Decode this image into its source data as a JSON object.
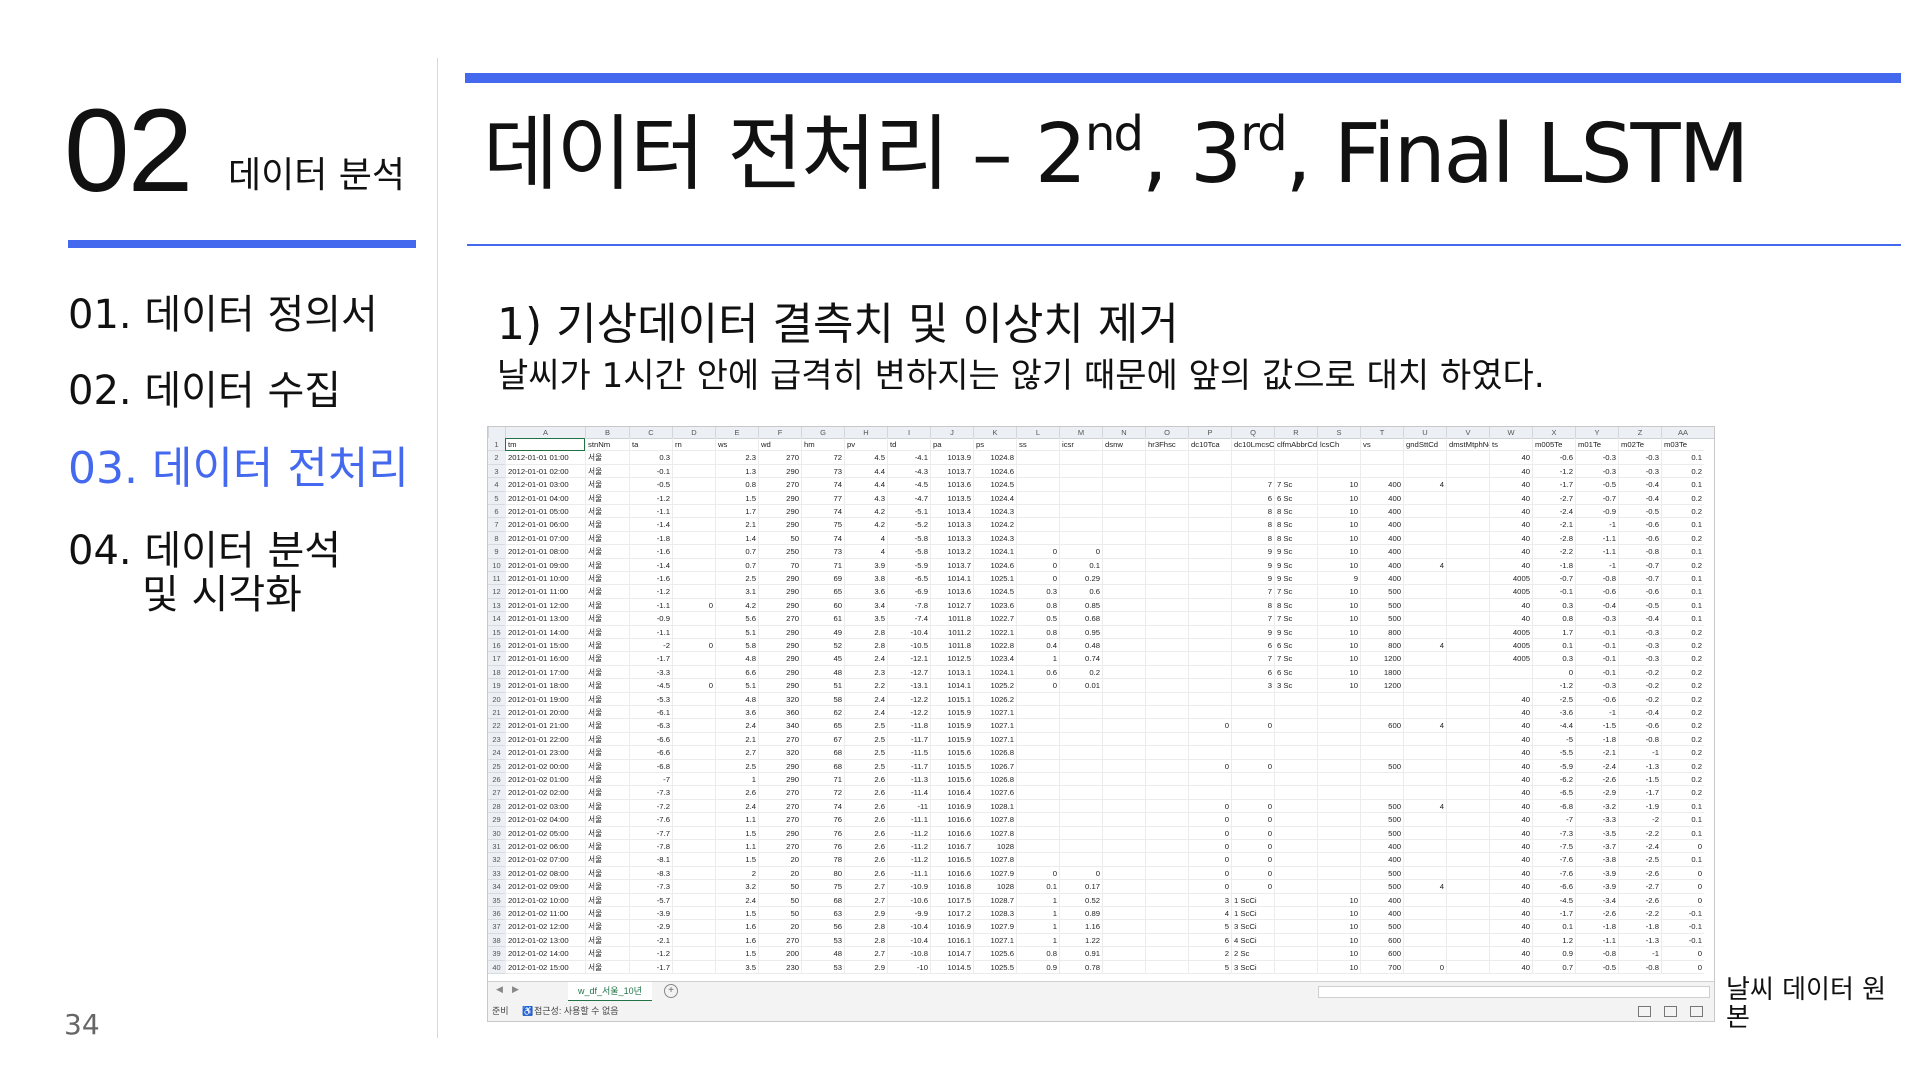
{
  "section": {
    "number": "02",
    "name": "데이터 분석"
  },
  "nav": {
    "items": [
      {
        "label": "01. 데이터 정의서"
      },
      {
        "label": "02. 데이터 수집"
      },
      {
        "label": "03. 데이터 전처리"
      },
      {
        "label": "04. 데이터 분석"
      },
      {
        "label": "및 시각화"
      }
    ]
  },
  "title": {
    "main": "데이터 전처리 – 2",
    "sup1": "nd",
    "mid": ", 3",
    "sup2": "rd",
    "tail": ", Final LSTM"
  },
  "subheading": "1) 기상데이터 결측치 및 이상치 제거",
  "description": "날씨가 1시간 안에 급격히 변하지는 않기 때문에 앞의 값으로 대치 하였다.",
  "caption": "날씨 데이터 원본",
  "page_number": "34",
  "accent_color": "#4469ef",
  "spreadsheet": {
    "columns": [
      "A",
      "B",
      "C",
      "D",
      "E",
      "F",
      "G",
      "H",
      "I",
      "J",
      "K",
      "L",
      "M",
      "N",
      "O",
      "P",
      "Q",
      "R",
      "S",
      "T",
      "U",
      "V",
      "W",
      "X",
      "Y",
      "Z",
      "AA"
    ],
    "header_row": [
      "tm",
      "stnNm",
      "ta",
      "rn",
      "ws",
      "wd",
      "hm",
      "pv",
      "td",
      "pa",
      "ps",
      "ss",
      "icsr",
      "dsnw",
      "hr3Fhsc",
      "dc10Tca",
      "dc10LmcsCa",
      "clfmAbbrCd",
      "lcsCh",
      "vs",
      "gndSttCd",
      "dmstMtphNo",
      "ts",
      "m005Te",
      "m01Te",
      "m02Te",
      "m03Te"
    ],
    "rows": [
      [
        "2012-01-01 01:00",
        "서울",
        "0.3",
        "",
        "2.3",
        "270",
        "72",
        "4.5",
        "-4.1",
        "1013.9",
        "1024.8",
        "",
        "",
        "",
        "",
        "",
        "",
        "",
        "",
        "",
        "",
        "",
        "40",
        "-0.6",
        "-0.3",
        "-0.3",
        "0.1"
      ],
      [
        "2012-01-01 02:00",
        "서울",
        "-0.1",
        "",
        "1.3",
        "290",
        "73",
        "4.4",
        "-4.3",
        "1013.7",
        "1024.6",
        "",
        "",
        "",
        "",
        "",
        "",
        "",
        "",
        "",
        "",
        "",
        "40",
        "-1.2",
        "-0.3",
        "-0.3",
        "0.2"
      ],
      [
        "2012-01-01 03:00",
        "서울",
        "-0.5",
        "",
        "0.8",
        "270",
        "74",
        "4.4",
        "-4.5",
        "1013.6",
        "1024.5",
        "",
        "",
        "",
        "",
        "",
        "7",
        "7 Sc",
        "10",
        "400",
        "4",
        "",
        "40",
        "-1.7",
        "-0.5",
        "-0.4",
        "0.1"
      ],
      [
        "2012-01-01 04:00",
        "서울",
        "-1.2",
        "",
        "1.5",
        "290",
        "77",
        "4.3",
        "-4.7",
        "1013.5",
        "1024.4",
        "",
        "",
        "",
        "",
        "",
        "6",
        "6 Sc",
        "10",
        "400",
        "",
        "",
        "40",
        "-2.7",
        "-0.7",
        "-0.4",
        "0.2"
      ],
      [
        "2012-01-01 05:00",
        "서울",
        "-1.1",
        "",
        "1.7",
        "290",
        "74",
        "4.2",
        "-5.1",
        "1013.4",
        "1024.3",
        "",
        "",
        "",
        "",
        "",
        "8",
        "8 Sc",
        "10",
        "400",
        "",
        "",
        "40",
        "-2.4",
        "-0.9",
        "-0.5",
        "0.2"
      ],
      [
        "2012-01-01 06:00",
        "서울",
        "-1.4",
        "",
        "2.1",
        "290",
        "75",
        "4.2",
        "-5.2",
        "1013.3",
        "1024.2",
        "",
        "",
        "",
        "",
        "",
        "8",
        "8 Sc",
        "10",
        "400",
        "",
        "",
        "40",
        "-2.1",
        "-1",
        "-0.6",
        "0.1"
      ],
      [
        "2012-01-01 07:00",
        "서울",
        "-1.8",
        "",
        "1.4",
        "50",
        "74",
        "4",
        "-5.8",
        "1013.3",
        "1024.3",
        "",
        "",
        "",
        "",
        "",
        "8",
        "8 Sc",
        "10",
        "400",
        "",
        "",
        "40",
        "-2.8",
        "-1.1",
        "-0.6",
        "0.2"
      ],
      [
        "2012-01-01 08:00",
        "서울",
        "-1.6",
        "",
        "0.7",
        "250",
        "73",
        "4",
        "-5.8",
        "1013.2",
        "1024.1",
        "0",
        "0",
        "",
        "",
        "",
        "9",
        "9 Sc",
        "10",
        "400",
        "",
        "",
        "40",
        "-2.2",
        "-1.1",
        "-0.8",
        "0.1"
      ],
      [
        "2012-01-01 09:00",
        "서울",
        "-1.4",
        "",
        "0.7",
        "70",
        "71",
        "3.9",
        "-5.9",
        "1013.7",
        "1024.6",
        "0",
        "0.1",
        "",
        "",
        "",
        "9",
        "9 Sc",
        "10",
        "400",
        "4",
        "",
        "40",
        "-1.8",
        "-1",
        "-0.7",
        "0.2"
      ],
      [
        "2012-01-01 10:00",
        "서울",
        "-1.6",
        "",
        "2.5",
        "290",
        "69",
        "3.8",
        "-6.5",
        "1014.1",
        "1025.1",
        "0",
        "0.29",
        "",
        "",
        "",
        "9",
        "9 Sc",
        "9",
        "400",
        "",
        "",
        "4005",
        "-0.7",
        "-0.8",
        "-0.7",
        "0.1"
      ],
      [
        "2012-01-01 11:00",
        "서울",
        "-1.2",
        "",
        "3.1",
        "290",
        "65",
        "3.6",
        "-6.9",
        "1013.6",
        "1024.5",
        "0.3",
        "0.6",
        "",
        "",
        "",
        "7",
        "7 Sc",
        "10",
        "500",
        "",
        "",
        "4005",
        "-0.1",
        "-0.6",
        "-0.6",
        "0.1"
      ],
      [
        "2012-01-01 12:00",
        "서울",
        "-1.1",
        "0",
        "4.2",
        "290",
        "60",
        "3.4",
        "-7.8",
        "1012.7",
        "1023.6",
        "0.8",
        "0.85",
        "",
        "",
        "",
        "8",
        "8 Sc",
        "10",
        "500",
        "",
        "",
        "40",
        "0.3",
        "-0.4",
        "-0.5",
        "0.1"
      ],
      [
        "2012-01-01 13:00",
        "서울",
        "-0.9",
        "",
        "5.6",
        "270",
        "61",
        "3.5",
        "-7.4",
        "1011.8",
        "1022.7",
        "0.5",
        "0.68",
        "",
        "",
        "",
        "7",
        "7 Sc",
        "10",
        "500",
        "",
        "",
        "40",
        "0.8",
        "-0.3",
        "-0.4",
        "0.1"
      ],
      [
        "2012-01-01 14:00",
        "서울",
        "-1.1",
        "",
        "5.1",
        "290",
        "49",
        "2.8",
        "-10.4",
        "1011.2",
        "1022.1",
        "0.8",
        "0.95",
        "",
        "",
        "",
        "9",
        "9 Sc",
        "10",
        "800",
        "",
        "",
        "4005",
        "1.7",
        "-0.1",
        "-0.3",
        "0.2"
      ],
      [
        "2012-01-01 15:00",
        "서울",
        "-2",
        "0",
        "5.8",
        "290",
        "52",
        "2.8",
        "-10.5",
        "1011.8",
        "1022.8",
        "0.4",
        "0.48",
        "",
        "",
        "",
        "6",
        "6 Sc",
        "10",
        "800",
        "4",
        "",
        "4005",
        "0.1",
        "-0.1",
        "-0.3",
        "0.2"
      ],
      [
        "2012-01-01 16:00",
        "서울",
        "-1.7",
        "",
        "4.8",
        "290",
        "45",
        "2.4",
        "-12.1",
        "1012.5",
        "1023.4",
        "1",
        "0.74",
        "",
        "",
        "",
        "7",
        "7 Sc",
        "10",
        "1200",
        "",
        "",
        "4005",
        "0.3",
        "-0.1",
        "-0.3",
        "0.2"
      ],
      [
        "2012-01-01 17:00",
        "서울",
        "-3.3",
        "",
        "6.6",
        "290",
        "48",
        "2.3",
        "-12.7",
        "1013.1",
        "1024.1",
        "0.6",
        "0.2",
        "",
        "",
        "",
        "6",
        "6 Sc",
        "10",
        "1800",
        "",
        "",
        "",
        "0",
        "-0.1",
        "-0.2",
        "0.2"
      ],
      [
        "2012-01-01 18:00",
        "서울",
        "-4.5",
        "0",
        "5.1",
        "290",
        "51",
        "2.2",
        "-13.1",
        "1014.1",
        "1025.2",
        "0",
        "0.01",
        "",
        "",
        "",
        "3",
        "3 Sc",
        "10",
        "1200",
        "",
        "",
        "",
        "-1.2",
        "-0.3",
        "-0.2",
        "0.2"
      ],
      [
        "2012-01-01 19:00",
        "서울",
        "-5.3",
        "",
        "4.8",
        "320",
        "58",
        "2.4",
        "-12.2",
        "1015.1",
        "1026.2",
        "",
        "",
        "",
        "",
        "",
        "",
        "",
        "",
        "",
        "",
        "",
        "40",
        "-2.5",
        "-0.6",
        "-0.2",
        "0.2"
      ],
      [
        "2012-01-01 20:00",
        "서울",
        "-6.1",
        "",
        "3.6",
        "360",
        "62",
        "2.4",
        "-12.2",
        "1015.9",
        "1027.1",
        "",
        "",
        "",
        "",
        "",
        "",
        "",
        "",
        "",
        "",
        "",
        "40",
        "-3.6",
        "-1",
        "-0.4",
        "0.2"
      ],
      [
        "2012-01-01 21:00",
        "서울",
        "-6.3",
        "",
        "2.4",
        "340",
        "65",
        "2.5",
        "-11.8",
        "1015.9",
        "1027.1",
        "",
        "",
        "",
        "",
        "0",
        "0",
        "",
        "",
        "600",
        "4",
        "",
        "40",
        "-4.4",
        "-1.5",
        "-0.6",
        "0.2"
      ],
      [
        "2012-01-01 22:00",
        "서울",
        "-6.6",
        "",
        "2.1",
        "270",
        "67",
        "2.5",
        "-11.7",
        "1015.9",
        "1027.1",
        "",
        "",
        "",
        "",
        "",
        "",
        "",
        "",
        "",
        "",
        "",
        "40",
        "-5",
        "-1.8",
        "-0.8",
        "0.2"
      ],
      [
        "2012-01-01 23:00",
        "서울",
        "-6.6",
        "",
        "2.7",
        "320",
        "68",
        "2.5",
        "-11.5",
        "1015.6",
        "1026.8",
        "",
        "",
        "",
        "",
        "",
        "",
        "",
        "",
        "",
        "",
        "",
        "40",
        "-5.5",
        "-2.1",
        "-1",
        "0.2"
      ],
      [
        "2012-01-02 00:00",
        "서울",
        "-6.8",
        "",
        "2.5",
        "290",
        "68",
        "2.5",
        "-11.7",
        "1015.5",
        "1026.7",
        "",
        "",
        "",
        "",
        "0",
        "0",
        "",
        "",
        "500",
        "",
        "",
        "40",
        "-5.9",
        "-2.4",
        "-1.3",
        "0.2"
      ],
      [
        "2012-01-02 01:00",
        "서울",
        "-7",
        "",
        "1",
        "290",
        "71",
        "2.6",
        "-11.3",
        "1015.6",
        "1026.8",
        "",
        "",
        "",
        "",
        "",
        "",
        "",
        "",
        "",
        "",
        "",
        "40",
        "-6.2",
        "-2.6",
        "-1.5",
        "0.2"
      ],
      [
        "2012-01-02 02:00",
        "서울",
        "-7.3",
        "",
        "2.6",
        "270",
        "72",
        "2.6",
        "-11.4",
        "1016.4",
        "1027.6",
        "",
        "",
        "",
        "",
        "",
        "",
        "",
        "",
        "",
        "",
        "",
        "40",
        "-6.5",
        "-2.9",
        "-1.7",
        "0.2"
      ],
      [
        "2012-01-02 03:00",
        "서울",
        "-7.2",
        "",
        "2.4",
        "270",
        "74",
        "2.6",
        "-11",
        "1016.9",
        "1028.1",
        "",
        "",
        "",
        "",
        "0",
        "0",
        "",
        "",
        "500",
        "4",
        "",
        "40",
        "-6.8",
        "-3.2",
        "-1.9",
        "0.1"
      ],
      [
        "2012-01-02 04:00",
        "서울",
        "-7.6",
        "",
        "1.1",
        "270",
        "76",
        "2.6",
        "-11.1",
        "1016.6",
        "1027.8",
        "",
        "",
        "",
        "",
        "0",
        "0",
        "",
        "",
        "500",
        "",
        "",
        "40",
        "-7",
        "-3.3",
        "-2",
        "0.1"
      ],
      [
        "2012-01-02 05:00",
        "서울",
        "-7.7",
        "",
        "1.5",
        "290",
        "76",
        "2.6",
        "-11.2",
        "1016.6",
        "1027.8",
        "",
        "",
        "",
        "",
        "0",
        "0",
        "",
        "",
        "500",
        "",
        "",
        "40",
        "-7.3",
        "-3.5",
        "-2.2",
        "0.1"
      ],
      [
        "2012-01-02 06:00",
        "서울",
        "-7.8",
        "",
        "1.1",
        "270",
        "76",
        "2.6",
        "-11.2",
        "1016.7",
        "1028",
        "",
        "",
        "",
        "",
        "0",
        "0",
        "",
        "",
        "400",
        "",
        "",
        "40",
        "-7.5",
        "-3.7",
        "-2.4",
        "0"
      ],
      [
        "2012-01-02 07:00",
        "서울",
        "-8.1",
        "",
        "1.5",
        "20",
        "78",
        "2.6",
        "-11.2",
        "1016.5",
        "1027.8",
        "",
        "",
        "",
        "",
        "0",
        "0",
        "",
        "",
        "400",
        "",
        "",
        "40",
        "-7.6",
        "-3.8",
        "-2.5",
        "0.1"
      ],
      [
        "2012-01-02 08:00",
        "서울",
        "-8.3",
        "",
        "2",
        "20",
        "80",
        "2.6",
        "-11.1",
        "1016.6",
        "1027.9",
        "0",
        "0",
        "",
        "",
        "0",
        "0",
        "",
        "",
        "500",
        "",
        "",
        "40",
        "-7.6",
        "-3.9",
        "-2.6",
        "0"
      ],
      [
        "2012-01-02 09:00",
        "서울",
        "-7.3",
        "",
        "3.2",
        "50",
        "75",
        "2.7",
        "-10.9",
        "1016.8",
        "1028",
        "0.1",
        "0.17",
        "",
        "",
        "0",
        "0",
        "",
        "",
        "500",
        "4",
        "",
        "40",
        "-6.6",
        "-3.9",
        "-2.7",
        "0"
      ],
      [
        "2012-01-02 10:00",
        "서울",
        "-5.7",
        "",
        "2.4",
        "50",
        "68",
        "2.7",
        "-10.6",
        "1017.5",
        "1028.7",
        "1",
        "0.52",
        "",
        "",
        "3",
        "1 ScCi",
        "",
        "10",
        "400",
        "",
        "",
        "40",
        "-4.5",
        "-3.4",
        "-2.6",
        "0"
      ],
      [
        "2012-01-02 11:00",
        "서울",
        "-3.9",
        "",
        "1.5",
        "50",
        "63",
        "2.9",
        "-9.9",
        "1017.2",
        "1028.3",
        "1",
        "0.89",
        "",
        "",
        "4",
        "1 ScCi",
        "",
        "10",
        "400",
        "",
        "",
        "40",
        "-1.7",
        "-2.6",
        "-2.2",
        "-0.1"
      ],
      [
        "2012-01-02 12:00",
        "서울",
        "-2.9",
        "",
        "1.6",
        "20",
        "56",
        "2.8",
        "-10.4",
        "1016.9",
        "1027.9",
        "1",
        "1.16",
        "",
        "",
        "5",
        "3 ScCi",
        "",
        "10",
        "500",
        "",
        "",
        "40",
        "0.1",
        "-1.8",
        "-1.8",
        "-0.1"
      ],
      [
        "2012-01-02 13:00",
        "서울",
        "-2.1",
        "",
        "1.6",
        "270",
        "53",
        "2.8",
        "-10.4",
        "1016.1",
        "1027.1",
        "1",
        "1.22",
        "",
        "",
        "6",
        "4 ScCi",
        "",
        "10",
        "600",
        "",
        "",
        "40",
        "1.2",
        "-1.1",
        "-1.3",
        "-0.1"
      ],
      [
        "2012-01-02 14:00",
        "서울",
        "-1.2",
        "",
        "1.5",
        "200",
        "48",
        "2.7",
        "-10.8",
        "1014.7",
        "1025.6",
        "0.8",
        "0.91",
        "",
        "",
        "2",
        "2 Sc",
        "",
        "10",
        "600",
        "",
        "",
        "40",
        "0.9",
        "-0.8",
        "-1",
        "0"
      ],
      [
        "2012-01-02 15:00",
        "서울",
        "-1.7",
        "",
        "3.5",
        "230",
        "53",
        "2.9",
        "-10",
        "1014.5",
        "1025.5",
        "0.9",
        "0.78",
        "",
        "",
        "5",
        "3 ScCi",
        "",
        "10",
        "700",
        "0",
        "",
        "40",
        "0.7",
        "-0.5",
        "-0.8",
        "0"
      ]
    ],
    "sheet_tab": "w_df_서울_10년",
    "status_ready": "준비",
    "status_accessibility": "접근성: 사용할 수 없음"
  }
}
